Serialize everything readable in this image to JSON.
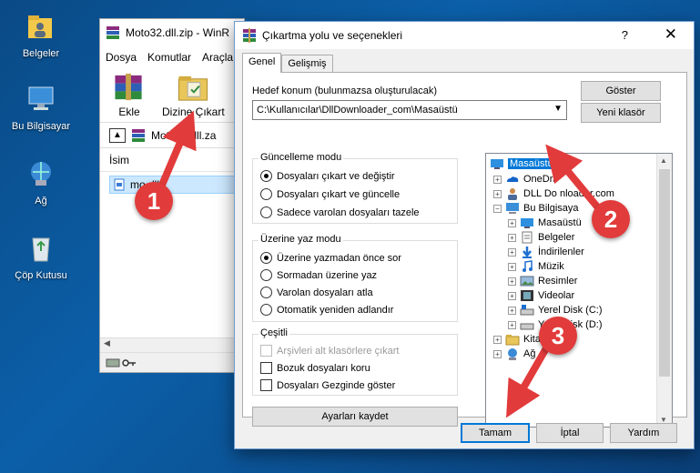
{
  "desktop": {
    "icons": [
      {
        "label": "Belgeler",
        "icon": "folder-user-icon"
      },
      {
        "label": "Bu Bilgisayar",
        "icon": "computer-icon"
      },
      {
        "label": "Ağ",
        "icon": "network-icon"
      },
      {
        "label": "Çöp Kutusu",
        "icon": "recycle-bin-icon"
      }
    ]
  },
  "winrar": {
    "title": "Moto32.dll.zip - WinR",
    "menu": [
      "Dosya",
      "Komutlar",
      "Araçla"
    ],
    "toolbar": {
      "add_label": "Ekle",
      "extract_label": "Dizine Çıkart"
    },
    "address": "Moto32.dll.za",
    "column_name": "İsim",
    "file_row": "mo   dll"
  },
  "dialog": {
    "title": "Çıkartma yolu ve seçenekleri",
    "help": "?",
    "close": "✕",
    "tabs": [
      "Genel",
      "Gelişmiş"
    ],
    "dest_label": "Hedef konum (bulunmazsa oluşturulacak)",
    "dest_value": "C:\\Kullanıcılar\\DllDownloader_com\\Masaüstü",
    "show_button": "Göster",
    "new_folder_button": "Yeni klasör",
    "update_group": {
      "title": "Güncelleme modu",
      "options": [
        "Dosyaları çıkart ve değiştir",
        "Dosyaları çıkart ve güncelle",
        "Sadece varolan dosyaları tazele"
      ],
      "selected": 0
    },
    "overwrite_group": {
      "title": "Üzerine yaz modu",
      "options": [
        "Üzerine yazmadan önce sor",
        "Sormadan üzerine yaz",
        "Varolan dosyaları atla",
        "Otomatik yeniden adlandır"
      ],
      "selected": 0
    },
    "misc_group": {
      "title": "Çeşitli",
      "options": [
        "Arşivleri alt klasörlere çıkart",
        "Bozuk dosyaları koru",
        "Dosyaları Gezginde göster"
      ]
    },
    "save_settings_button": "Ayarları kaydet",
    "tree": [
      {
        "label": "Masaüstü",
        "icon": "desktop-icon"
      },
      {
        "label": "OneDri",
        "icon": "onedrive-icon"
      },
      {
        "label": "DLL Do   nloader.com",
        "icon": "user-icon"
      },
      {
        "label": "Bu Bilgisaya",
        "icon": "computer-icon"
      },
      {
        "label": "Masaüstü",
        "icon": "desktop-icon"
      },
      {
        "label": "Belgeler",
        "icon": "documents-icon"
      },
      {
        "label": "İndirilenler",
        "icon": "downloads-icon"
      },
      {
        "label": "Müzik",
        "icon": "music-icon"
      },
      {
        "label": "Resimler",
        "icon": "pictures-icon"
      },
      {
        "label": "Videolar",
        "icon": "videos-icon"
      },
      {
        "label": "Yerel Disk (C:)",
        "icon": "drive-icon"
      },
      {
        "label": "Yerel Disk (D:)",
        "icon": "drive-icon"
      },
      {
        "label": "Kitaplıklar",
        "icon": "libraries-icon"
      },
      {
        "label": "Ağ",
        "icon": "network-icon"
      }
    ],
    "ok_button": "Tamam",
    "cancel_button": "İptal",
    "help_button": "Yardım"
  },
  "annotations": {
    "step1": "1",
    "step2": "2",
    "step3": "3"
  },
  "colors": {
    "accent": "#0078d7",
    "annotation": "#e23b3b",
    "desktop": "#0b5fa8"
  }
}
